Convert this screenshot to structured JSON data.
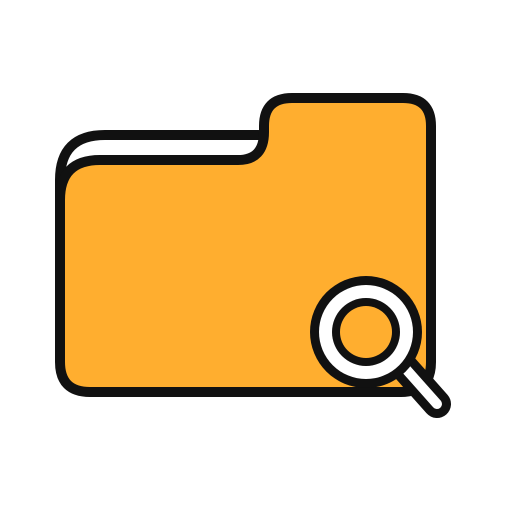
{
  "icon": {
    "name": "folder-search-icon",
    "colors": {
      "folder_fill": "#FFAE2F",
      "outline": "#111111",
      "paper": "#FFFFFF",
      "background": "#FFFFFF"
    },
    "parts": [
      "folder-icon",
      "search-icon"
    ]
  }
}
